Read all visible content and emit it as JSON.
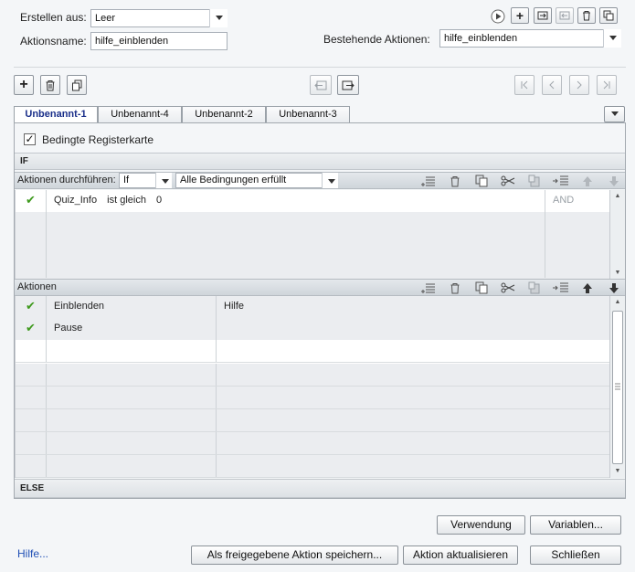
{
  "top": {
    "create_from_label": "Erstellen aus:",
    "create_from_value": "Leer",
    "action_name_label": "Aktionsname:",
    "action_name_value": "hilfe_einblenden",
    "existing_label": "Bestehende Aktionen:",
    "existing_value": "hilfe_einblenden"
  },
  "tabs": [
    {
      "label": "Unbenannt-1"
    },
    {
      "label": "Unbenannt-4"
    },
    {
      "label": "Unbenannt-2"
    },
    {
      "label": "Unbenannt-3"
    }
  ],
  "conditional": {
    "checkbox_label": "Bedingte Registerkarte",
    "checked": true
  },
  "if_section": {
    "header": "IF",
    "perform_label": "Aktionen durchführen:",
    "perform_value": "If",
    "conditions_value": "Alle Bedingungen erfüllt",
    "rows": [
      {
        "variable": "Quiz_Info",
        "operator": "ist gleich",
        "value": "0",
        "logic": "AND"
      }
    ]
  },
  "actions_section": {
    "header": "Aktionen",
    "rows": [
      {
        "action": "Einblenden",
        "target": "Hilfe"
      },
      {
        "action": "Pause",
        "target": ""
      }
    ]
  },
  "else_section": {
    "header": "ELSE"
  },
  "buttons": {
    "usage": "Verwendung",
    "variables": "Variablen...",
    "help": "Hilfe...",
    "save_shared": "Als freigegebene Aktion speichern...",
    "update": "Aktion aktualisieren",
    "close": "Schließen"
  },
  "icons": {
    "check": "✔",
    "plus": "+",
    "trash": "🗑",
    "copy": "⧉",
    "scissors": "✂"
  }
}
